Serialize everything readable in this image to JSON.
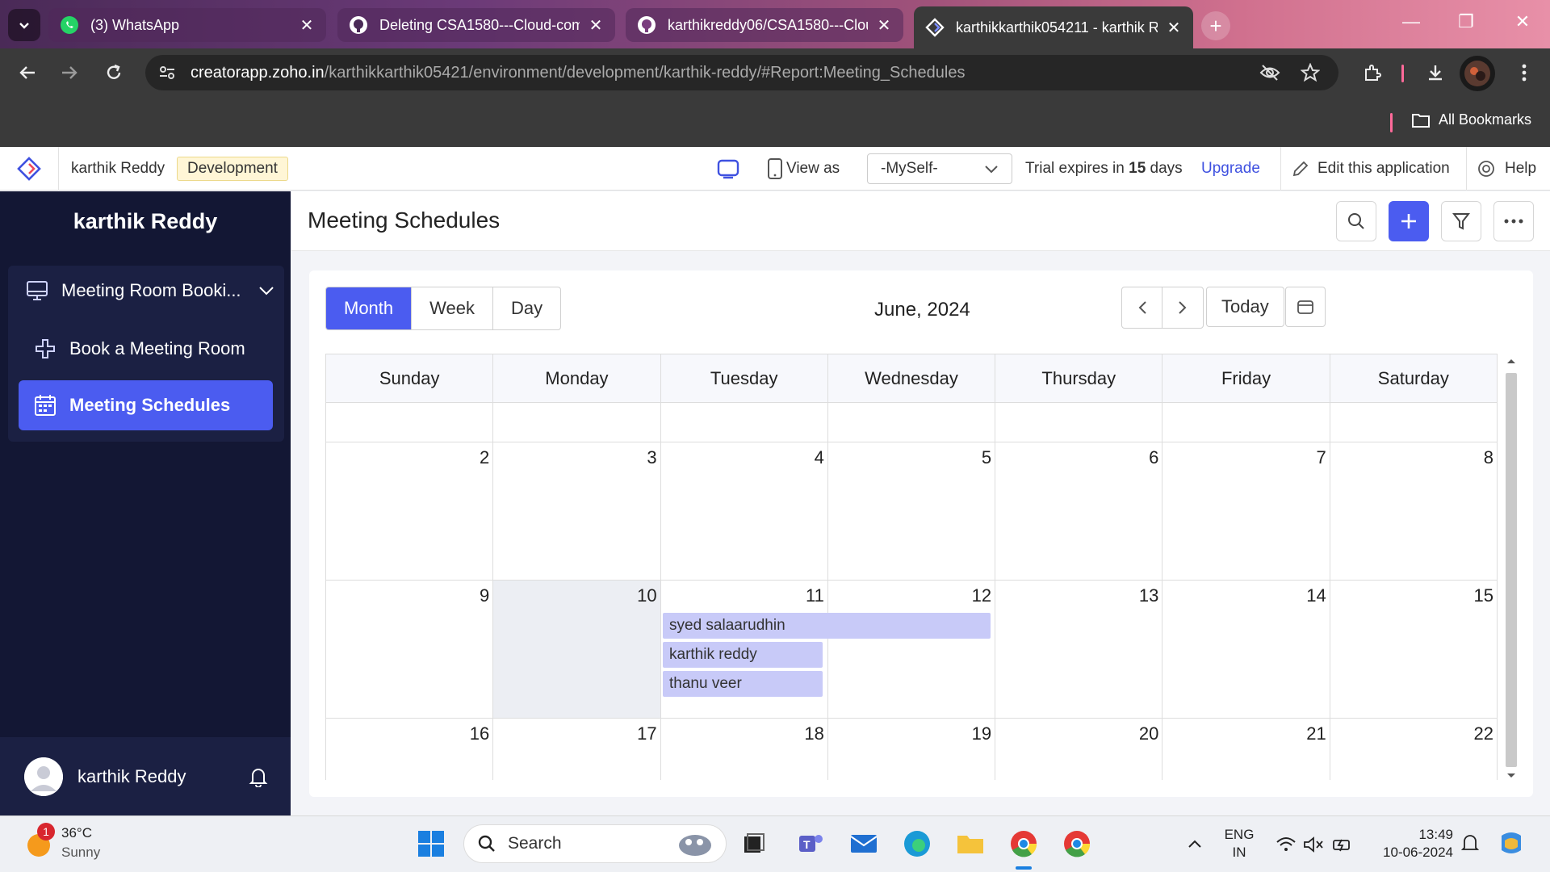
{
  "browser": {
    "tabs": [
      {
        "title": "(3) WhatsApp",
        "icon": "whatsapp-icon"
      },
      {
        "title": "Deleting CSA1580---Cloud-com",
        "icon": "github-icon"
      },
      {
        "title": "karthikreddy06/CSA1580---Clou",
        "icon": "github-icon"
      },
      {
        "title": "karthikkarthik054211 - karthik R",
        "icon": "zoho-creator-icon",
        "active": true
      }
    ],
    "url_host": "creatorapp.zoho.in",
    "url_path": "/karthikkarthik05421/environment/development/karthik-reddy/#Report:Meeting_Schedules",
    "bookmarks_label": "All Bookmarks"
  },
  "appbar": {
    "app_name": "karthik Reddy",
    "env_badge": "Development",
    "view_as_label": "View as",
    "view_as_value": "-MySelf-",
    "trial_prefix": "Trial expires in ",
    "trial_days": "15",
    "trial_suffix": " days",
    "upgrade": "Upgrade",
    "edit_app": "Edit this application",
    "help": "Help"
  },
  "sidebar": {
    "app_title": "karthik Reddy",
    "section": "Meeting Room Booki...",
    "items": [
      {
        "label": "Book a Meeting Room",
        "icon": "form-plus-icon"
      },
      {
        "label": "Meeting Schedules",
        "icon": "calendar-icon",
        "active": true
      }
    ],
    "user_name": "karthik Reddy"
  },
  "page": {
    "title": "Meeting Schedules"
  },
  "calendar": {
    "views": [
      "Month",
      "Week",
      "Day"
    ],
    "active_view": "Month",
    "month_label": "June, 2024",
    "today_label": "Today",
    "weekdays": [
      "Sunday",
      "Monday",
      "Tuesday",
      "Wednesday",
      "Thursday",
      "Friday",
      "Saturday"
    ],
    "weeks": [
      [
        "",
        "",
        "",
        "",
        "",
        "",
        ""
      ],
      [
        "2",
        "3",
        "4",
        "5",
        "6",
        "7",
        "8"
      ],
      [
        "9",
        "10",
        "11",
        "12",
        "13",
        "14",
        "15"
      ],
      [
        "16",
        "17",
        "18",
        "19",
        "20",
        "21",
        "22"
      ]
    ],
    "events": [
      {
        "title": "syed salaarudhin"
      },
      {
        "title": "karthik reddy"
      },
      {
        "title": "thanu veer"
      }
    ]
  },
  "taskbar": {
    "weather_temp": "36°C",
    "weather_desc": "Sunny",
    "weather_badge": "1",
    "search_placeholder": "Search",
    "lang_top": "ENG",
    "lang_bottom": "IN",
    "time": "13:49",
    "date": "10-06-2024"
  },
  "colors": {
    "accent": "#4b5cf0",
    "sidebar_bg": "#131734",
    "event_bg": "#c8caf8"
  }
}
